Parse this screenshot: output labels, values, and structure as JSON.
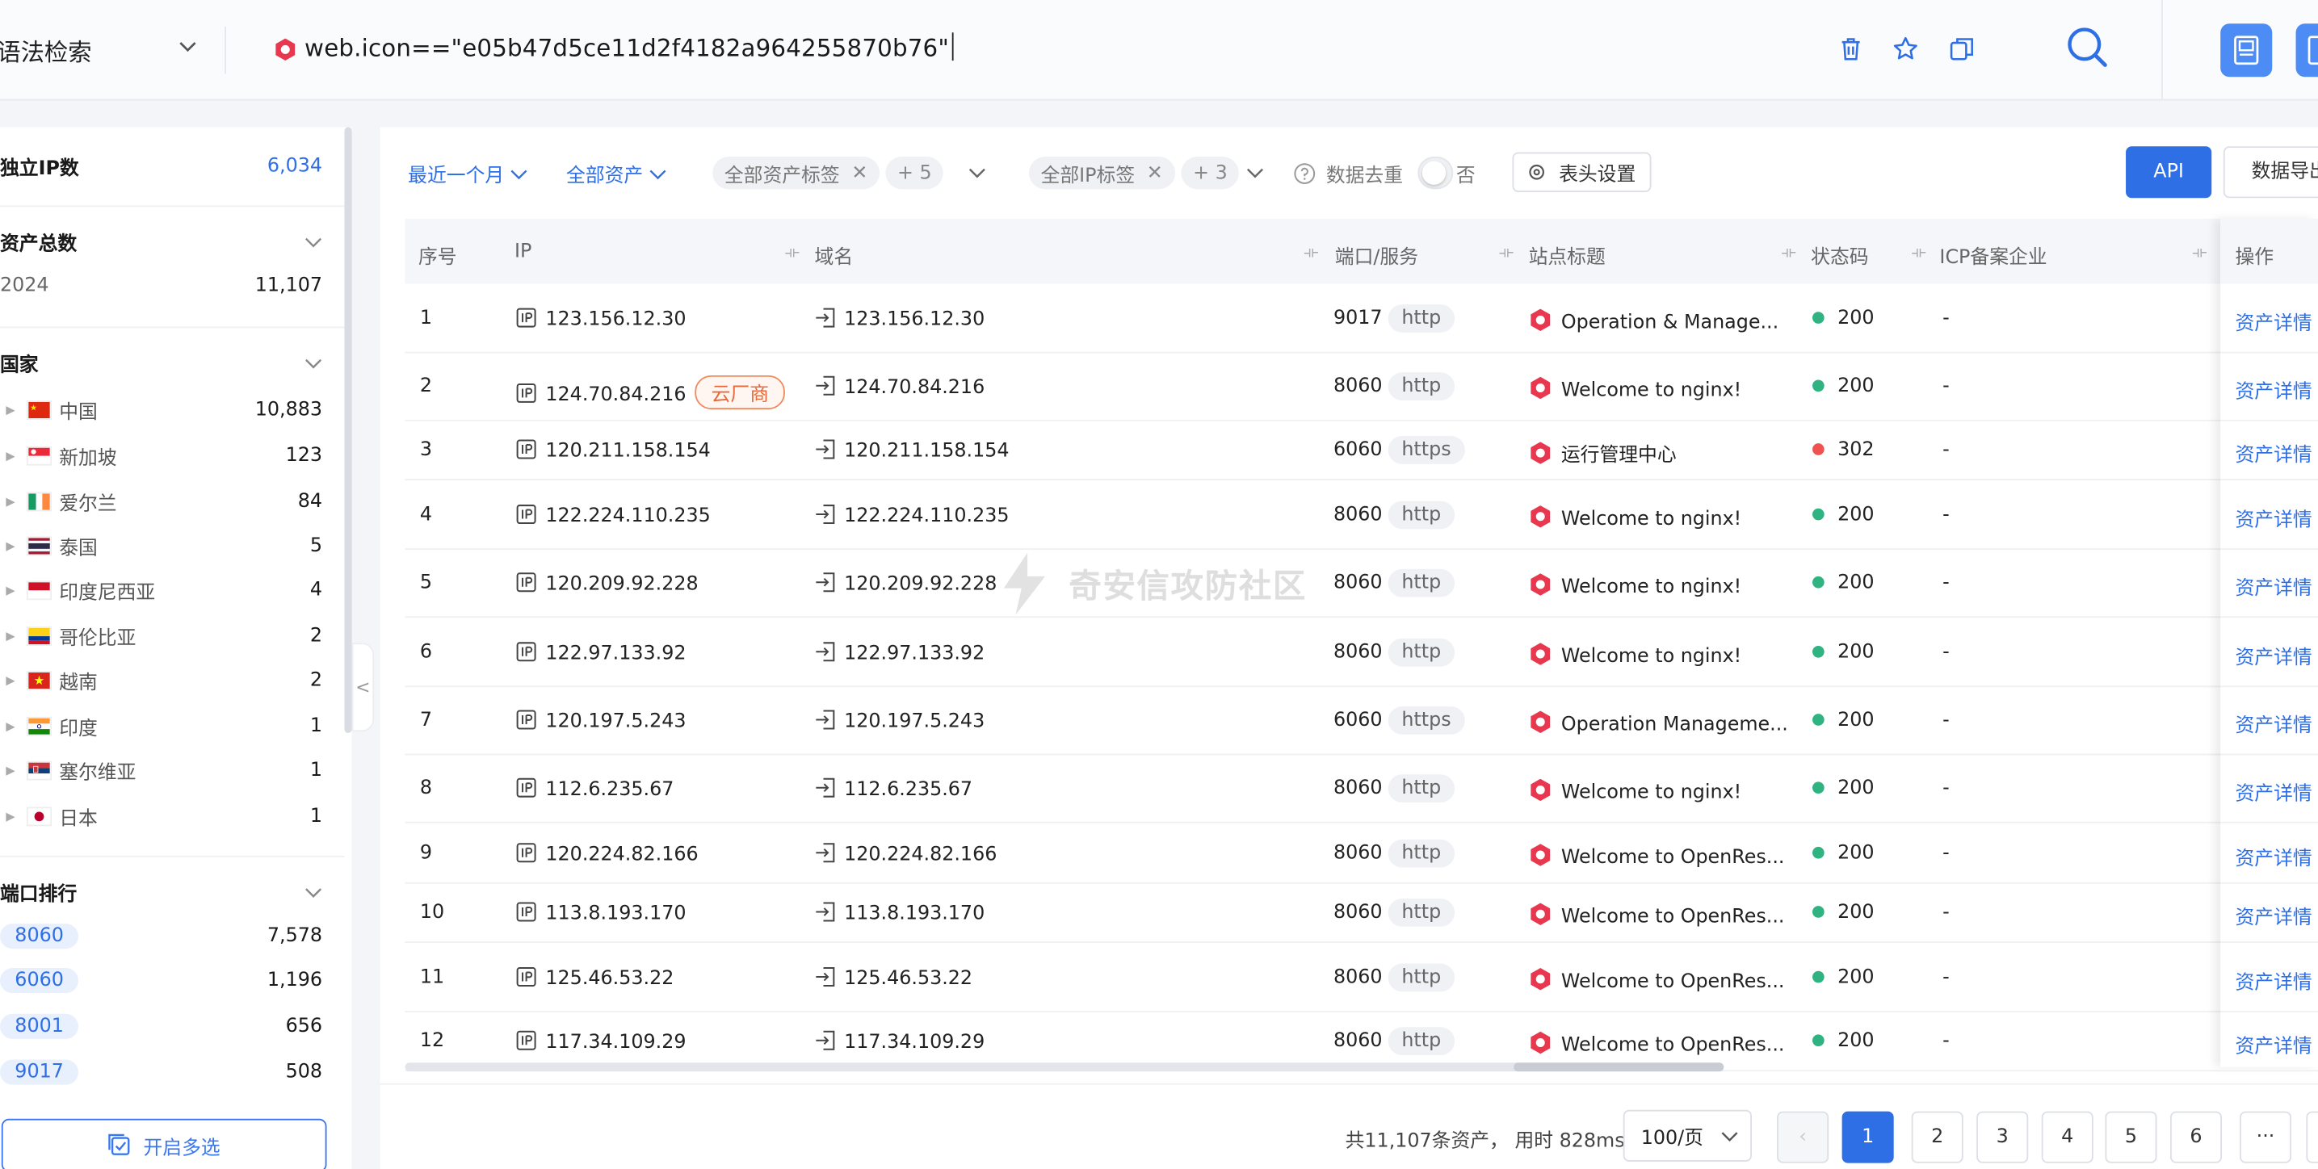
{
  "topbar": {
    "syntax_label": "语法检索",
    "query": "web.icon==\"e05b47d5ce11d2f4182a964255870b76\""
  },
  "sidebar": {
    "unique_ip_label": "独立IP数",
    "unique_ip_value": "6,034",
    "asset_total_label": "资产总数",
    "year_label": "2024",
    "year_value": "11,107",
    "country_label": "国家",
    "countries": [
      {
        "name": "中国",
        "count": "10,883"
      },
      {
        "name": "新加坡",
        "count": "123"
      },
      {
        "name": "爱尔兰",
        "count": "84"
      },
      {
        "name": "泰国",
        "count": "5"
      },
      {
        "name": "印度尼西亚",
        "count": "4"
      },
      {
        "name": "哥伦比亚",
        "count": "2"
      },
      {
        "name": "越南",
        "count": "2"
      },
      {
        "name": "印度",
        "count": "1"
      },
      {
        "name": "塞尔维亚",
        "count": "1"
      },
      {
        "name": "日本",
        "count": "1"
      }
    ],
    "port_rank_label": "端口排行",
    "ports": [
      {
        "port": "8060",
        "count": "7,578"
      },
      {
        "port": "6060",
        "count": "1,196"
      },
      {
        "port": "8001",
        "count": "656"
      },
      {
        "port": "9017",
        "count": "508"
      }
    ],
    "multi_select_label": "开启多选",
    "collapse_glyph": "<"
  },
  "filters": {
    "time_range": "最近一个月",
    "asset_scope": "全部资产",
    "asset_tag": "全部资产标签",
    "asset_tag_more": "+ 5",
    "ip_tag": "全部IP标签",
    "ip_tag_more": "+ 3",
    "dedupe_label": "数据去重",
    "dedupe_value": "否",
    "column_settings": "表头设置",
    "api_label": "API",
    "export_label": "数据导出"
  },
  "table": {
    "headers": {
      "idx": "序号",
      "ip": "IP",
      "domain": "域名",
      "port": "端口/服务",
      "title": "站点标题",
      "status": "状态码",
      "icp": "ICP备案企业",
      "action": "操作"
    },
    "rows": [
      {
        "idx": "1",
        "ip": "123.156.12.30",
        "cloud": "",
        "domain": "123.156.12.30",
        "port": "9017",
        "svc": "http",
        "title": "Operation & Manage...",
        "status": "200",
        "status_color": "#2fb380",
        "icp": "-",
        "action": "资产详情"
      },
      {
        "idx": "2",
        "ip": "124.70.84.216",
        "cloud": "云厂商",
        "domain": "124.70.84.216",
        "port": "8060",
        "svc": "http",
        "title": "Welcome to nginx!",
        "status": "200",
        "status_color": "#2fb380",
        "icp": "-",
        "action": "资产详情"
      },
      {
        "idx": "3",
        "ip": "120.211.158.154",
        "cloud": "",
        "domain": "120.211.158.154",
        "port": "6060",
        "svc": "https",
        "title": "运行管理中心",
        "status": "302",
        "status_color": "#f05252",
        "icp": "-",
        "action": "资产详情"
      },
      {
        "idx": "4",
        "ip": "122.224.110.235",
        "cloud": "",
        "domain": "122.224.110.235",
        "port": "8060",
        "svc": "http",
        "title": "Welcome to nginx!",
        "status": "200",
        "status_color": "#2fb380",
        "icp": "-",
        "action": "资产详情"
      },
      {
        "idx": "5",
        "ip": "120.209.92.228",
        "cloud": "",
        "domain": "120.209.92.228",
        "port": "8060",
        "svc": "http",
        "title": "Welcome to nginx!",
        "status": "200",
        "status_color": "#2fb380",
        "icp": "-",
        "action": "资产详情"
      },
      {
        "idx": "6",
        "ip": "122.97.133.92",
        "cloud": "",
        "domain": "122.97.133.92",
        "port": "8060",
        "svc": "http",
        "title": "Welcome to nginx!",
        "status": "200",
        "status_color": "#2fb380",
        "icp": "-",
        "action": "资产详情"
      },
      {
        "idx": "7",
        "ip": "120.197.5.243",
        "cloud": "",
        "domain": "120.197.5.243",
        "port": "6060",
        "svc": "https",
        "title": "Operation Manageme...",
        "status": "200",
        "status_color": "#2fb380",
        "icp": "-",
        "action": "资产详情"
      },
      {
        "idx": "8",
        "ip": "112.6.235.67",
        "cloud": "",
        "domain": "112.6.235.67",
        "port": "8060",
        "svc": "http",
        "title": "Welcome to nginx!",
        "status": "200",
        "status_color": "#2fb380",
        "icp": "-",
        "action": "资产详情"
      },
      {
        "idx": "9",
        "ip": "120.224.82.166",
        "cloud": "",
        "domain": "120.224.82.166",
        "port": "8060",
        "svc": "http",
        "title": "Welcome to OpenRes...",
        "status": "200",
        "status_color": "#2fb380",
        "icp": "-",
        "action": "资产详情"
      },
      {
        "idx": "10",
        "ip": "113.8.193.170",
        "cloud": "",
        "domain": "113.8.193.170",
        "port": "8060",
        "svc": "http",
        "title": "Welcome to OpenRes...",
        "status": "200",
        "status_color": "#2fb380",
        "icp": "-",
        "action": "资产详情"
      },
      {
        "idx": "11",
        "ip": "125.46.53.22",
        "cloud": "",
        "domain": "125.46.53.22",
        "port": "8060",
        "svc": "http",
        "title": "Welcome to OpenRes...",
        "status": "200",
        "status_color": "#2fb380",
        "icp": "-",
        "action": "资产详情"
      },
      {
        "idx": "12",
        "ip": "117.34.109.29",
        "cloud": "",
        "domain": "117.34.109.29",
        "port": "8060",
        "svc": "http",
        "title": "Welcome to OpenRes...",
        "status": "200",
        "status_color": "#2fb380",
        "icp": "-",
        "action": "资产详情"
      }
    ]
  },
  "footer": {
    "total_text": "共11,107条资产，",
    "time_text": "用时 828ms",
    "page_size": "100/页",
    "pages": [
      "1",
      "2",
      "3",
      "4",
      "5",
      "6"
    ],
    "more": "···",
    "current_page": "1"
  },
  "watermark": "奇安信攻防社区",
  "colors": {
    "accent": "#2f6fe6",
    "ok": "#2fb380",
    "redirect": "#f05252",
    "cloud": "#e8683a",
    "icon_red": "#e8384f"
  }
}
